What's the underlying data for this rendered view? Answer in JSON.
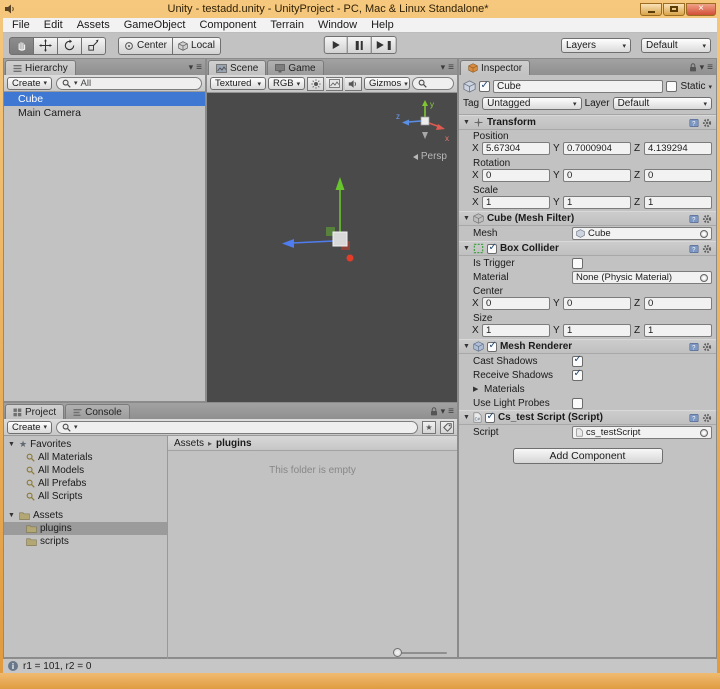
{
  "window": {
    "title": "Unity - testadd.unity - UnityProject - PC, Mac & Linux Standalone*",
    "status_text": "r1 = 101, r2 = 0"
  },
  "menu": {
    "items": [
      "File",
      "Edit",
      "Assets",
      "GameObject",
      "Component",
      "Terrain",
      "Window",
      "Help"
    ]
  },
  "toolbar": {
    "center": "Center",
    "local": "Local",
    "layers": "Layers",
    "layout": "Default"
  },
  "axis": {
    "x": "X",
    "y": "Y",
    "z": "Z"
  },
  "hierarchy": {
    "tab": "Hierarchy",
    "create": "Create",
    "search_mode": "All",
    "items": [
      {
        "label": "Cube"
      },
      {
        "label": "Main Camera"
      }
    ]
  },
  "scene": {
    "tab_scene": "Scene",
    "tab_game": "Game",
    "render_mode": "Textured",
    "channel": "RGB",
    "gizmos": "Gizmos",
    "persp": "Persp",
    "axes": {
      "x": "x",
      "y": "y",
      "z": "z"
    }
  },
  "inspector": {
    "tab": "Inspector",
    "name": "Cube",
    "static_label": "Static",
    "tag_label": "Tag",
    "tag_value": "Untagged",
    "layer_label": "Layer",
    "layer_value": "Default",
    "transform": {
      "title": "Transform",
      "position_label": "Position",
      "rotation_label": "Rotation",
      "scale_label": "Scale",
      "position": {
        "x": "5.67304",
        "y": "0.7000904",
        "z": "4.139294"
      },
      "rotation": {
        "x": "0",
        "y": "0",
        "z": "0"
      },
      "scale": {
        "x": "1",
        "y": "1",
        "z": "1"
      }
    },
    "mesh_filter": {
      "title": "Cube (Mesh Filter)",
      "mesh_label": "Mesh",
      "mesh_value": "Cube"
    },
    "box_collider": {
      "title": "Box Collider",
      "is_trigger_label": "Is Trigger",
      "material_label": "Material",
      "material_value": "None (Physic Material)",
      "center_label": "Center",
      "size_label": "Size",
      "center": {
        "x": "0",
        "y": "0",
        "z": "0"
      },
      "size": {
        "x": "1",
        "y": "1",
        "z": "1"
      }
    },
    "mesh_renderer": {
      "title": "Mesh Renderer",
      "cast_shadows": "Cast Shadows",
      "receive_shadows": "Receive Shadows",
      "materials": "Materials",
      "use_light_probes": "Use Light Probes"
    },
    "script": {
      "title": "Cs_test Script (Script)",
      "script_label": "Script",
      "script_value": "cs_testScript"
    },
    "add_component": "Add Component"
  },
  "project": {
    "tab_project": "Project",
    "tab_console": "Console",
    "create": "Create",
    "favorites_label": "Favorites",
    "favorites": [
      {
        "label": "All Materials"
      },
      {
        "label": "All Models"
      },
      {
        "label": "All Prefabs"
      },
      {
        "label": "All Scripts"
      }
    ],
    "assets_label": "Assets",
    "folders": [
      {
        "label": "plugins"
      },
      {
        "label": "scripts"
      }
    ],
    "breadcrumb": {
      "root": "Assets",
      "separator": "▸",
      "current": "plugins"
    },
    "empty_message": "This folder is empty"
  }
}
